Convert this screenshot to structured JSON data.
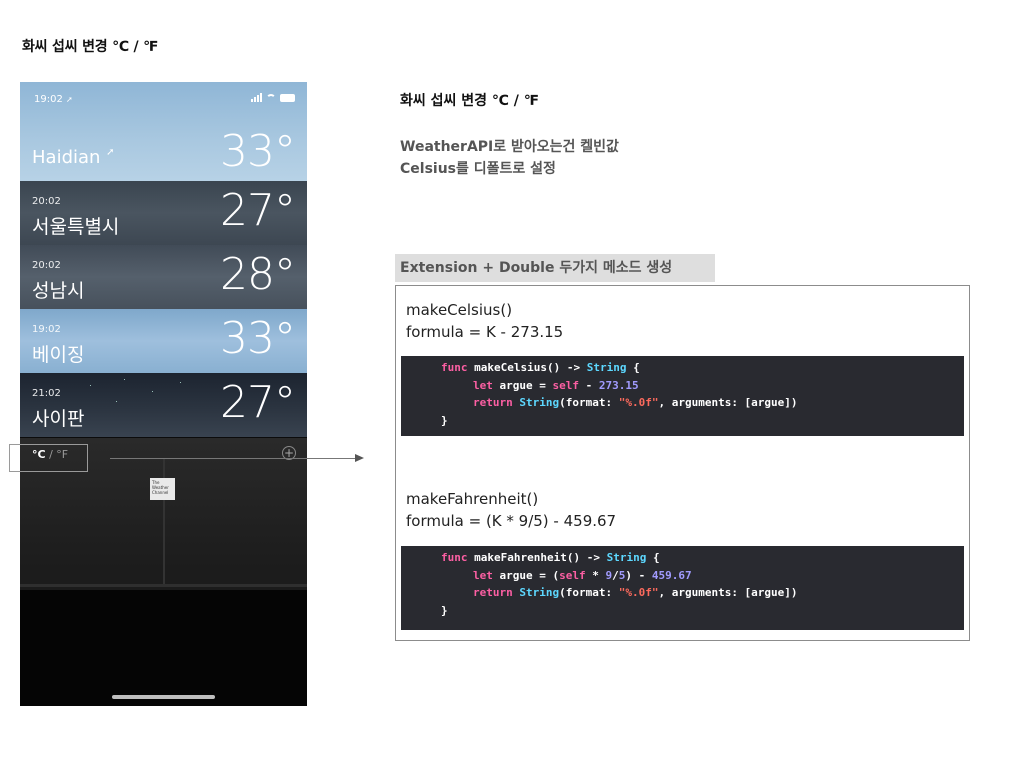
{
  "page": {
    "title": "화씨 섭씨 변경  ℃ / ℉"
  },
  "phone": {
    "status_time": "19:02",
    "status_location_arrow": "➚",
    "cities": [
      {
        "time": "",
        "name": "Haidian",
        "temp": "33°",
        "current_location": true
      },
      {
        "time": "20:02",
        "name": "서울특별시",
        "temp": "27°"
      },
      {
        "time": "20:02",
        "name": "성남시",
        "temp": "28°"
      },
      {
        "time": "19:02",
        "name": "베이징",
        "temp": "33°"
      },
      {
        "time": "21:02",
        "name": "사이판",
        "temp": "27°"
      }
    ],
    "unit_toggle": {
      "celsius": "°C",
      "separator": " / ",
      "fahrenheit": "°F"
    },
    "weather_logo_text": "The Weather Channel",
    "icons": [
      "location-arrow-icon",
      "signal-icon",
      "wifi-icon",
      "battery-icon",
      "plus-icon"
    ]
  },
  "notes": {
    "title": "화씨 섭씨 변경  ℃ / ℉",
    "line1": "WeatherAPI로 받아오는건 켈빈값",
    "line2": "Celsius를 디폴트로 설정",
    "section_label": "Extension + Double 두가지 메소드 생성"
  },
  "functions": [
    {
      "name": "makeCelsius()",
      "formula": "formula = K - 273.15",
      "code": [
        {
          "indent": 0,
          "tokens": [
            [
              "kw",
              "func "
            ],
            [
              "plain",
              "makeCelsius() -> "
            ],
            [
              "ty",
              "String"
            ],
            [
              "plain",
              " {"
            ]
          ]
        },
        {
          "indent": 1,
          "tokens": [
            [
              "kw",
              "let "
            ],
            [
              "plain",
              "argue = "
            ],
            [
              "kw",
              "self"
            ],
            [
              "plain",
              " - "
            ],
            [
              "num",
              "273.15"
            ]
          ]
        },
        {
          "indent": 1,
          "tokens": [
            [
              "kw",
              "return "
            ],
            [
              "ty",
              "String"
            ],
            [
              "plain",
              "(format: "
            ],
            [
              "str",
              "\"%.0f\""
            ],
            [
              "plain",
              ", arguments: [argue])"
            ]
          ]
        },
        {
          "indent": 0,
          "tokens": [
            [
              "plain",
              "}"
            ]
          ]
        }
      ]
    },
    {
      "name": "makeFahrenheit()",
      "formula": "formula = (K * 9/5) - 459.67",
      "code": [
        {
          "indent": 0,
          "tokens": [
            [
              "kw",
              "func "
            ],
            [
              "plain",
              "makeFahrenheit() -> "
            ],
            [
              "ty",
              "String"
            ],
            [
              "plain",
              " {"
            ]
          ]
        },
        {
          "indent": 1,
          "tokens": [
            [
              "kw",
              "let "
            ],
            [
              "plain",
              "argue = ("
            ],
            [
              "kw",
              "self"
            ],
            [
              "plain",
              " * "
            ],
            [
              "num",
              "9"
            ],
            [
              "plain",
              "/"
            ],
            [
              "num",
              "5"
            ],
            [
              "plain",
              ") - "
            ],
            [
              "num",
              "459.67"
            ]
          ]
        },
        {
          "indent": 1,
          "tokens": [
            [
              "kw",
              "return "
            ],
            [
              "ty",
              "String"
            ],
            [
              "plain",
              "(format: "
            ],
            [
              "str",
              "\"%.0f\""
            ],
            [
              "plain",
              ", arguments: [argue])"
            ]
          ]
        },
        {
          "indent": 0,
          "tokens": [
            [
              "plain",
              "}"
            ]
          ]
        }
      ]
    }
  ],
  "colors": {
    "code_bg": "#292a30",
    "keyword": "#fc5fa3",
    "type": "#5dd8ff",
    "number": "#a19bfe",
    "string": "#fc6a5d",
    "section_bg": "#dedede"
  }
}
